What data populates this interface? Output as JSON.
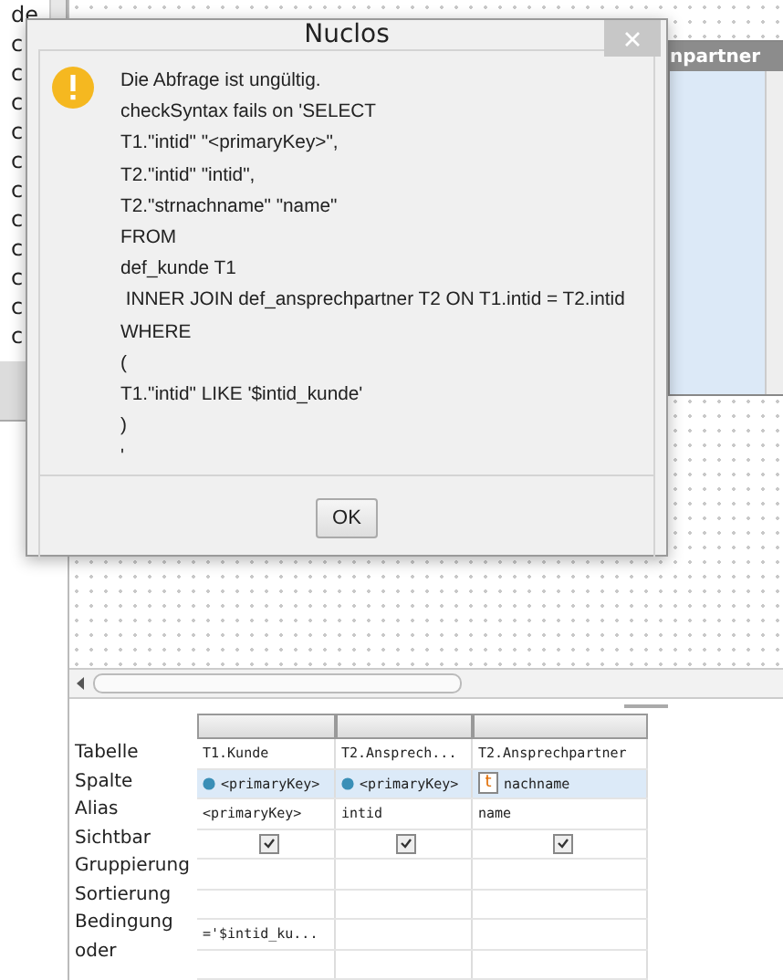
{
  "left_list": {
    "items": [
      "de",
      "c",
      "c",
      "c",
      "c",
      "c",
      "c",
      "c",
      "c",
      "c",
      "c",
      "c"
    ]
  },
  "canvas": {
    "entity_box": {
      "title": "npartner"
    }
  },
  "dialog": {
    "title": "Nuclos",
    "message_lines": [
      "Die Abfrage ist ungültig.",
      "checkSyntax fails on 'SELECT",
      "T1.\"intid\" \"<primaryKey>\",",
      "T2.\"intid\" \"intid\",",
      "T2.\"strnachname\" \"name\"",
      "FROM",
      "def_kunde T1",
      " INNER JOIN def_ansprechpartner T2 ON T1.intid = T2.intid",
      "WHERE",
      "(",
      "T1.\"intid\" LIKE '$intid_kunde'",
      ")",
      "'"
    ],
    "buttons": [
      "OK"
    ]
  },
  "query_grid": {
    "rows": [
      {
        "label": "Tabelle",
        "selected": false
      },
      {
        "label": "Spalte",
        "selected": true
      },
      {
        "label": "Alias",
        "selected": false
      },
      {
        "label": "Sichtbar",
        "selected": false
      },
      {
        "label": "Gruppierung",
        "selected": false
      },
      {
        "label": "Sortierung",
        "selected": false
      },
      {
        "label": "Bedingung",
        "selected": false
      },
      {
        "label": "oder",
        "selected": false
      }
    ],
    "columns": [
      {
        "table": "T1.Kunde",
        "column": {
          "kind": "key",
          "name": "<primaryKey>"
        },
        "alias": "<primaryKey>",
        "visible": true,
        "condition": "='$intid_ku..."
      },
      {
        "table": "T2.Ansprech...",
        "column": {
          "kind": "key",
          "name": "<primaryKey>"
        },
        "alias": "intid",
        "visible": true
      },
      {
        "table": "T2.Ansprechpartner",
        "column": {
          "kind": "text",
          "type_label": "t",
          "name": "nachname"
        },
        "alias": "name",
        "visible": true
      }
    ]
  }
}
